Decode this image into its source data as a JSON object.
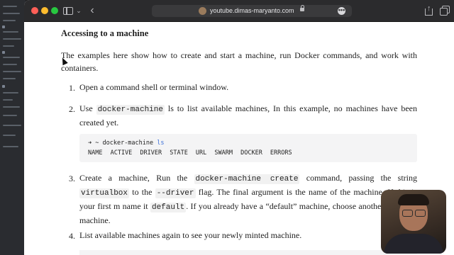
{
  "browser": {
    "url": "youtube.dimas-maryanto.com",
    "more_glyph": "•••"
  },
  "article": {
    "heading": "Accessing to a machine",
    "intro": "The examples here show how to create and start a machine, run Docker commands, and work with containers.",
    "steps": [
      {
        "num": "1.",
        "text": "Open a command shell or terminal window."
      },
      {
        "num": "2.",
        "pre": "Use ",
        "code1": "docker-machine",
        "post": " ls to list available machines, In this example, no machines have been created yet."
      },
      {
        "num": "3.",
        "pre": "Create a machine, Run the ",
        "code1": "docker-machine create",
        "mid1": " command, passing the string ",
        "code2": "virtualbox",
        "mid2": " to the ",
        "code3": "--driver",
        "mid3": " flag. The final argument is the name of the machine. If this is your first m",
        "mid3b": " name it ",
        "code4": "default",
        "post": ". If you already have a “default” machine, choose another name for machine."
      },
      {
        "num": "4.",
        "text": "List available machines again to see your newly minted machine."
      }
    ],
    "codeblock": {
      "prompt": "➜ ~",
      "command": "docker-machine",
      "arg": "ls",
      "header": "NAME ACTIVE DRIVER STATE URL SWARM DOCKER ERRORS"
    }
  },
  "colors": {
    "toolbar": "#2b2b2d",
    "keyword": "#3a6fd8",
    "code_bg": "#f4f4f5"
  },
  "icons": [
    "sidebar-icon",
    "chevron-down-icon",
    "back-icon",
    "lock-icon",
    "more-icon",
    "share-icon",
    "tabs-icon"
  ]
}
